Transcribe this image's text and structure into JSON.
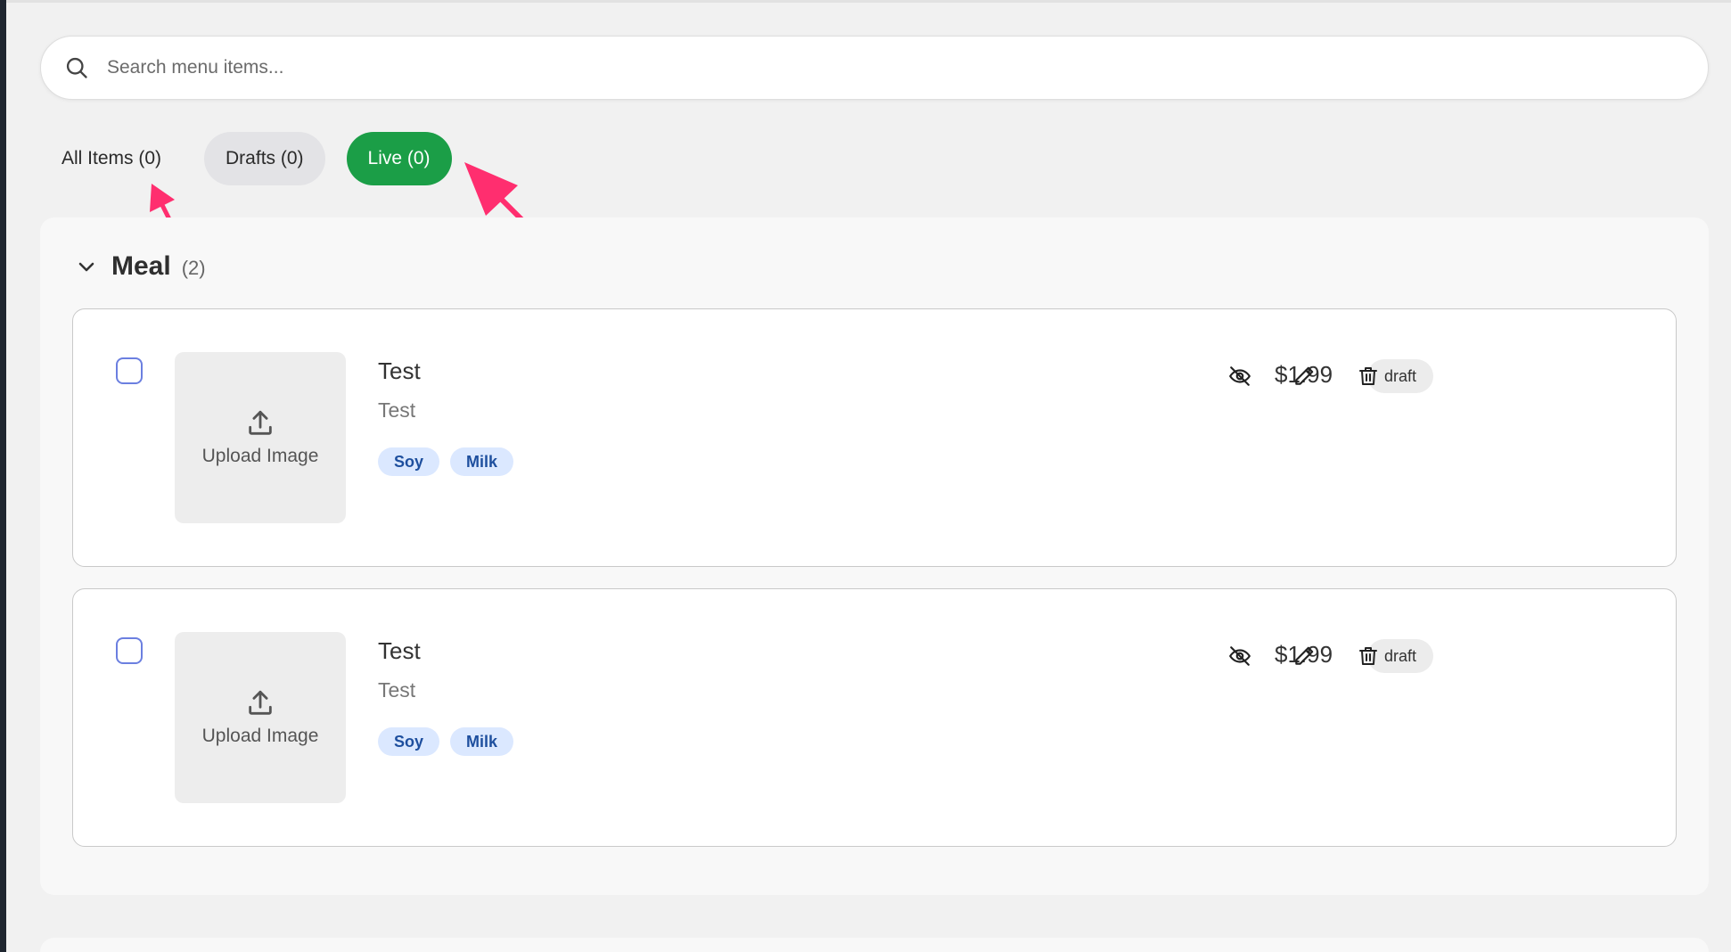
{
  "search": {
    "placeholder": "Search menu items..."
  },
  "tabs": [
    {
      "label": "All Items (0)"
    },
    {
      "label": "Drafts (0)"
    },
    {
      "label": "Live (0)"
    }
  ],
  "colors": {
    "live_tab": "#1b9e47",
    "tag_bg": "#dbe8ff",
    "tag_text": "#1e4f9e",
    "annotation_arrow": "#ff2e6f",
    "checkbox_border": "#6b7fe0"
  },
  "group": {
    "title": "Meal",
    "count": "(2)"
  },
  "items": [
    {
      "name": "Test",
      "description": "Test",
      "tags": [
        "Soy",
        "Milk"
      ],
      "price": "$1.99",
      "status": "draft",
      "upload_label": "Upload Image"
    },
    {
      "name": "Test",
      "description": "Test",
      "tags": [
        "Soy",
        "Milk"
      ],
      "price": "$1.99",
      "status": "draft",
      "upload_label": "Upload Image"
    }
  ],
  "icons": [
    "search-icon",
    "chevron-down-icon",
    "upload-icon",
    "eye-off-icon",
    "pencil-icon",
    "trash-icon"
  ]
}
